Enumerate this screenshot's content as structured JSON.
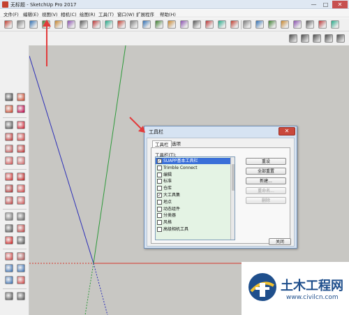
{
  "window": {
    "title": "无标题 - SketchUp Pro 2017",
    "min_symbol": "—",
    "max_symbol": "□",
    "close_symbol": "✕"
  },
  "menu": [
    "文件(F)",
    "编辑(E)",
    "视图(V)",
    "相机(C)",
    "绘图(R)",
    "工具(T)",
    "窗口(W)",
    "扩展程序",
    "帮助(H)"
  ],
  "toolbar_top_icons": [
    "select-icon",
    "eraser-icon",
    "paint-icon",
    "line-icon",
    "arc-icon",
    "rectangle-icon",
    "circle-icon",
    "polygon-icon",
    "pushpull-icon",
    "move-icon",
    "rotate-icon",
    "scale-icon",
    "offset-icon",
    "tape-icon",
    "dimension-icon",
    "protractor-icon",
    "text-icon",
    "axes-icon",
    "3dtext-icon",
    "orbit-icon",
    "pan-icon",
    "zoom-icon",
    "zoom-extents-icon",
    "section-icon",
    "sandbox-icon",
    "warehouse-icon",
    "extension-icon"
  ],
  "toolbar_second_icons": [
    "component-icon",
    "layers-icon",
    "home-icon",
    "house-icon",
    "settings-icon"
  ],
  "dialog": {
    "title": "工具栏",
    "close_symbol": "✕",
    "tabs": [
      "工具栏",
      "选项"
    ],
    "list_label": "工具栏(T):",
    "items": [
      {
        "label": "SUAPP基本工具栏",
        "checked": true,
        "selected": true
      },
      {
        "label": "Trimble Connect",
        "checked": false,
        "selected": false
      },
      {
        "label": "编辑",
        "checked": false,
        "selected": false
      },
      {
        "label": "标准",
        "checked": false,
        "selected": false
      },
      {
        "label": "仓库",
        "checked": false,
        "selected": false
      },
      {
        "label": "大工具集",
        "checked": true,
        "selected": false
      },
      {
        "label": "地点",
        "checked": false,
        "selected": false
      },
      {
        "label": "动态组件",
        "checked": false,
        "selected": false
      },
      {
        "label": "分类器",
        "checked": false,
        "selected": false
      },
      {
        "label": "风格",
        "checked": false,
        "selected": false
      },
      {
        "label": "高级相机工具",
        "checked": false,
        "selected": false
      }
    ],
    "buttons": {
      "reset": "重设",
      "reset_all": "全部重置",
      "new": "新建...",
      "rename": "重命名...",
      "delete": "删除",
      "close": "关闭"
    }
  },
  "watermark": {
    "title": "土木工程网",
    "url": "www.civilcn.com"
  },
  "colors": {
    "viewport_bg": "#c8c7c3",
    "axis_red": "#d6342b",
    "axis_green": "#2d9a3a",
    "axis_blue": "#2c2fb8",
    "annotation_red": "#e23b3b",
    "list_bg": "#e4f3e4",
    "selected_row": "#3a6fd8",
    "watermark_blue": "#1f4f8c"
  }
}
